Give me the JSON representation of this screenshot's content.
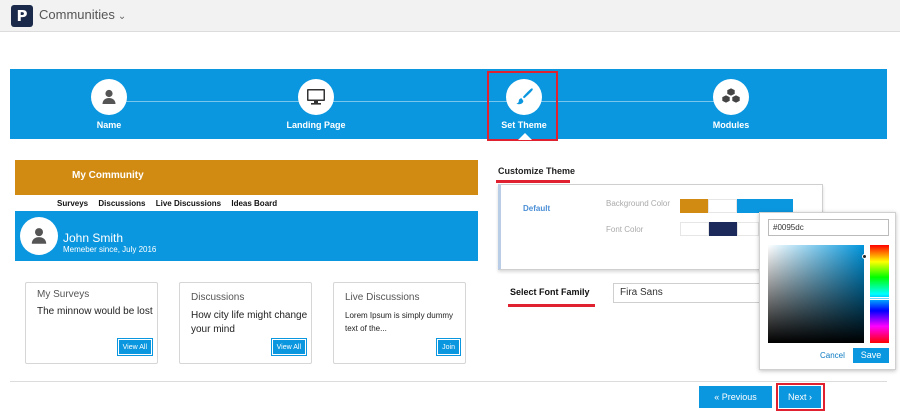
{
  "app": {
    "logo_letter": "P",
    "title": "Communities"
  },
  "wizard": {
    "steps": [
      {
        "label": "Name",
        "icon": "person-icon",
        "active": false
      },
      {
        "label": "Landing Page",
        "icon": "monitor-icon",
        "active": false
      },
      {
        "label": "Set Theme",
        "icon": "paintbrush-icon",
        "active": true
      },
      {
        "label": "Modules",
        "icon": "cubes-icon",
        "active": false
      }
    ]
  },
  "preview": {
    "community_name": "My Community",
    "nav_links": [
      "Surveys",
      "Discussions",
      "Live Discussions",
      "Ideas Board"
    ],
    "user_name": "John Smith",
    "member_since": "Memeber since, July 2016",
    "cards": [
      {
        "title": "My Surveys",
        "body": "The minnow would be lost",
        "button": "View All"
      },
      {
        "title": "Discussions",
        "body": "How city life might change your mind",
        "button": "View All"
      },
      {
        "title": "Live Discussions",
        "body": "Lorem Ipsum is simply dummy text of the...",
        "button": "Join"
      }
    ]
  },
  "customize": {
    "title": "Customize Theme",
    "preset_label": "Default",
    "background_color_label": "Background Color",
    "font_color_label": "Font Color",
    "select_font_family_label": "Select Font Family",
    "font_family_value": "Fira Sans"
  },
  "color_picker": {
    "hex_value": "#0095dc",
    "cancel_label": "Cancel",
    "save_label": "Save"
  },
  "footer": {
    "previous_label": "« Previous",
    "next_label": "Next ›"
  },
  "colors": {
    "primary_blue": "#0b97df",
    "banner_orange": "#d18b12",
    "navy": "#1b2a4a",
    "highlight_red": "#e0212f"
  }
}
